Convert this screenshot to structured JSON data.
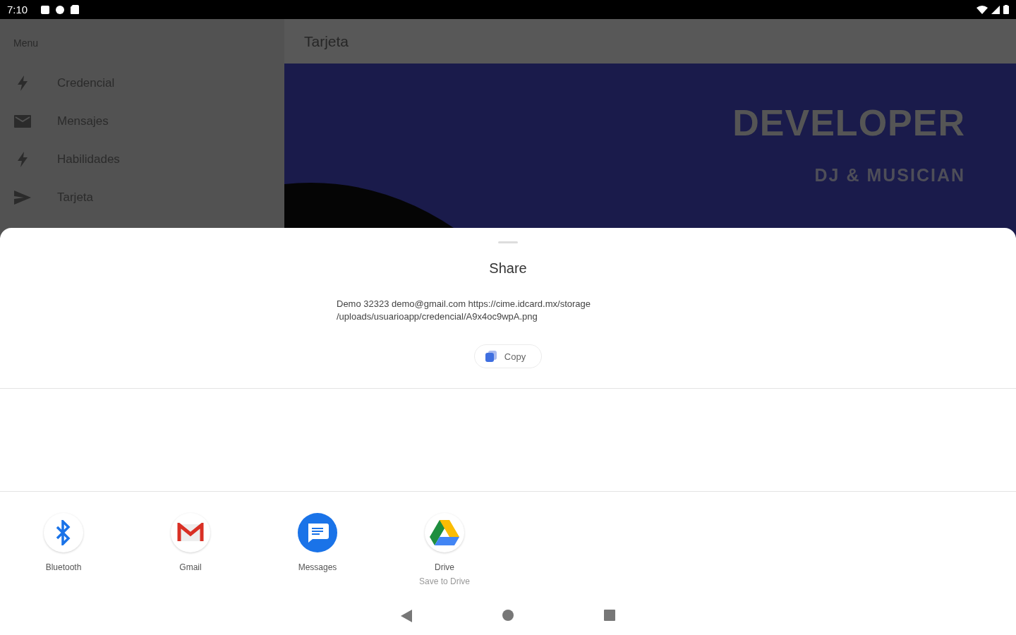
{
  "status_bar": {
    "time": "7:10"
  },
  "drawer": {
    "header": "Menu",
    "items": [
      {
        "label": "Credencial",
        "kind": "bolt"
      },
      {
        "label": "Mensajes",
        "kind": "mail"
      },
      {
        "label": "Habilidades",
        "kind": "bolt"
      },
      {
        "label": "Tarjeta",
        "kind": "send"
      }
    ]
  },
  "toolbar": {
    "title": "Tarjeta"
  },
  "card": {
    "title": "DEVELOPER",
    "subtitle": "DJ & MUSICIAN"
  },
  "share_sheet": {
    "title": "Share",
    "text": "Demo 32323 demo@gmail.com https://cime.idcard.mx/storage\n/uploads/usuarioapp/credencial/A9x4oc9wpA.png",
    "copy_button": "Copy",
    "apps": [
      {
        "label": "Bluetooth",
        "kind": "bluetooth"
      },
      {
        "label": "Gmail",
        "kind": "gmail"
      },
      {
        "label": "Messages",
        "kind": "messages"
      },
      {
        "label": "Drive",
        "sublabel": "Save to Drive",
        "kind": "drive"
      }
    ]
  }
}
